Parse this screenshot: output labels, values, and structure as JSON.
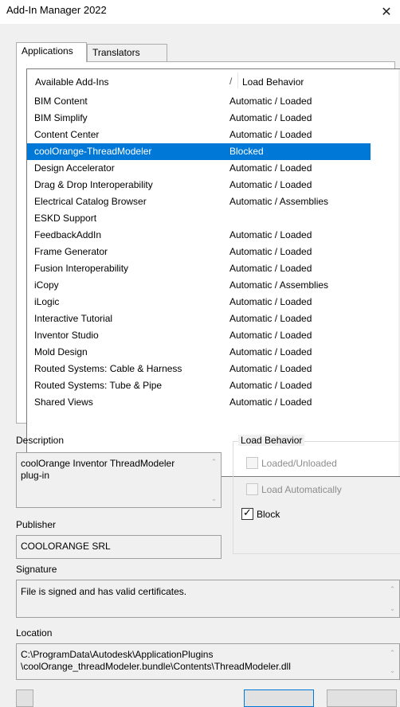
{
  "window": {
    "title": "Add-In Manager 2022",
    "close_glyph": "✕"
  },
  "tabs": [
    {
      "label": "Applications",
      "active": true
    },
    {
      "label": "Translators",
      "active": false
    }
  ],
  "addins_list": {
    "column_name": "Available Add-Ins",
    "column_separator": "/",
    "column_behavior": "Load Behavior",
    "rows": [
      {
        "name": "BIM Content",
        "behavior": "Automatic / Loaded"
      },
      {
        "name": "BIM Simplify",
        "behavior": "Automatic / Loaded"
      },
      {
        "name": "Content Center",
        "behavior": "Automatic / Loaded"
      },
      {
        "name": "coolOrange-ThreadModeler",
        "behavior": "Blocked",
        "selected": true
      },
      {
        "name": "Design Accelerator",
        "behavior": "Automatic / Loaded"
      },
      {
        "name": "Drag & Drop Interoperability",
        "behavior": "Automatic / Loaded"
      },
      {
        "name": "Electrical Catalog Browser",
        "behavior": "Automatic / Assemblies"
      },
      {
        "name": "ESKD Support",
        "behavior": ""
      },
      {
        "name": "FeedbackAddIn",
        "behavior": "Automatic / Loaded"
      },
      {
        "name": "Frame Generator",
        "behavior": "Automatic / Loaded"
      },
      {
        "name": "Fusion Interoperability",
        "behavior": "Automatic / Loaded"
      },
      {
        "name": "iCopy",
        "behavior": "Automatic / Assemblies"
      },
      {
        "name": "iLogic",
        "behavior": "Automatic / Loaded"
      },
      {
        "name": "Interactive Tutorial",
        "behavior": "Automatic / Loaded"
      },
      {
        "name": "Inventor Studio",
        "behavior": "Automatic / Loaded"
      },
      {
        "name": "Mold Design",
        "behavior": "Automatic / Loaded"
      },
      {
        "name": "Routed Systems: Cable & Harness",
        "behavior": "Automatic / Loaded"
      },
      {
        "name": "Routed Systems: Tube & Pipe",
        "behavior": "Automatic / Loaded"
      },
      {
        "name": "Shared Views",
        "behavior": "Automatic / Loaded"
      }
    ],
    "scroll_up_icon": "chevron-up-icon",
    "scroll_down_icon": "chevron-down-icon"
  },
  "description": {
    "label": "Description",
    "value": "coolOrange Inventor ThreadModeler plug-in"
  },
  "publisher": {
    "label": "Publisher",
    "value": "COOLORANGE SRL"
  },
  "load_behavior": {
    "legend": "Load Behavior",
    "loaded_unloaded": {
      "label": "Loaded/Unloaded",
      "checked": false,
      "enabled": false
    },
    "load_automatically": {
      "label": "Load Automatically",
      "checked": false,
      "enabled": false
    },
    "block": {
      "label": "Block",
      "checked": true,
      "enabled": true
    }
  },
  "signature": {
    "label": "Signature",
    "value": "File is signed and has valid certificates."
  },
  "location": {
    "label": "Location",
    "line1": "C:\\ProgramData\\Autodesk\\ApplicationPlugins",
    "line2": "\\coolOrange_threadModeler.bundle\\Contents\\ThreadModeler.dll"
  },
  "colors": {
    "selection": "#0078d7",
    "window_bg": "#f0f0f0"
  }
}
